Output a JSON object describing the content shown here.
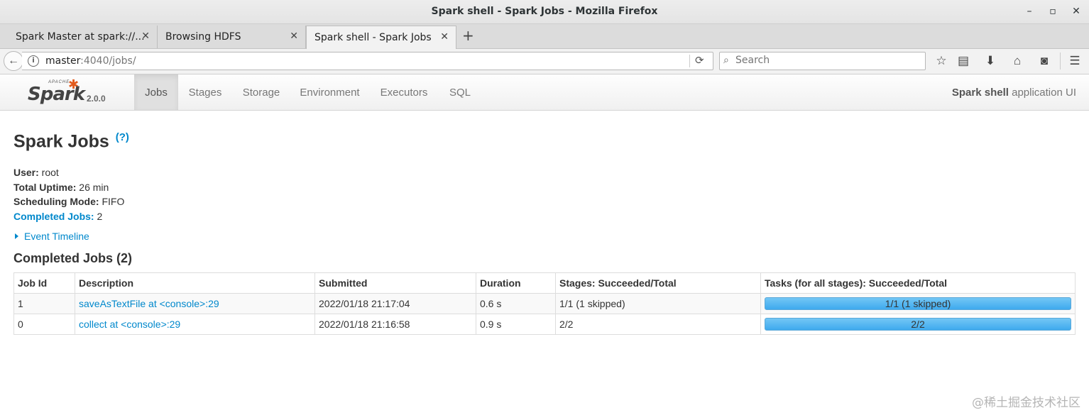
{
  "window": {
    "title": "Spark shell - Spark Jobs - Mozilla Firefox"
  },
  "tabs": [
    {
      "label": "Spark Master at spark://..."
    },
    {
      "label": "Browsing HDFS"
    },
    {
      "label": "Spark shell - Spark Jobs"
    }
  ],
  "urlbar": {
    "host": "master",
    "rest": ":4040/jobs/"
  },
  "search": {
    "placeholder": "Search"
  },
  "spark": {
    "logo_small": "APACHE",
    "logo_text": "Spark",
    "version": "2.0.0",
    "nav": [
      "Jobs",
      "Stages",
      "Storage",
      "Environment",
      "Executors",
      "SQL"
    ],
    "app_name_bold": "Spark shell",
    "app_name_rest": " application UI"
  },
  "page": {
    "title": "Spark Jobs",
    "help": "(?)",
    "user_label": "User:",
    "user_value": " root",
    "uptime_label": "Total Uptime:",
    "uptime_value": " 26 min",
    "sched_label": "Scheduling Mode:",
    "sched_value": " FIFO",
    "completed_label": "Completed Jobs:",
    "completed_value": " 2",
    "timeline": "Event Timeline",
    "section_title": "Completed Jobs (2)"
  },
  "table": {
    "headers": [
      "Job Id",
      "Description",
      "Submitted",
      "Duration",
      "Stages: Succeeded/Total",
      "Tasks (for all stages): Succeeded/Total"
    ],
    "rows": [
      {
        "id": "1",
        "desc": "saveAsTextFile at <console>:29",
        "submitted": "2022/01/18 21:17:04",
        "duration": "0.6 s",
        "stages": "1/1 (1 skipped)",
        "tasks": "1/1 (1 skipped)",
        "tasks_fraction": 1.0
      },
      {
        "id": "0",
        "desc": "collect at <console>:29",
        "submitted": "2022/01/18 21:16:58",
        "duration": "0.9 s",
        "stages": "2/2",
        "tasks": "2/2",
        "tasks_fraction": 1.0
      }
    ]
  },
  "watermark": "@稀土掘金技术社区"
}
